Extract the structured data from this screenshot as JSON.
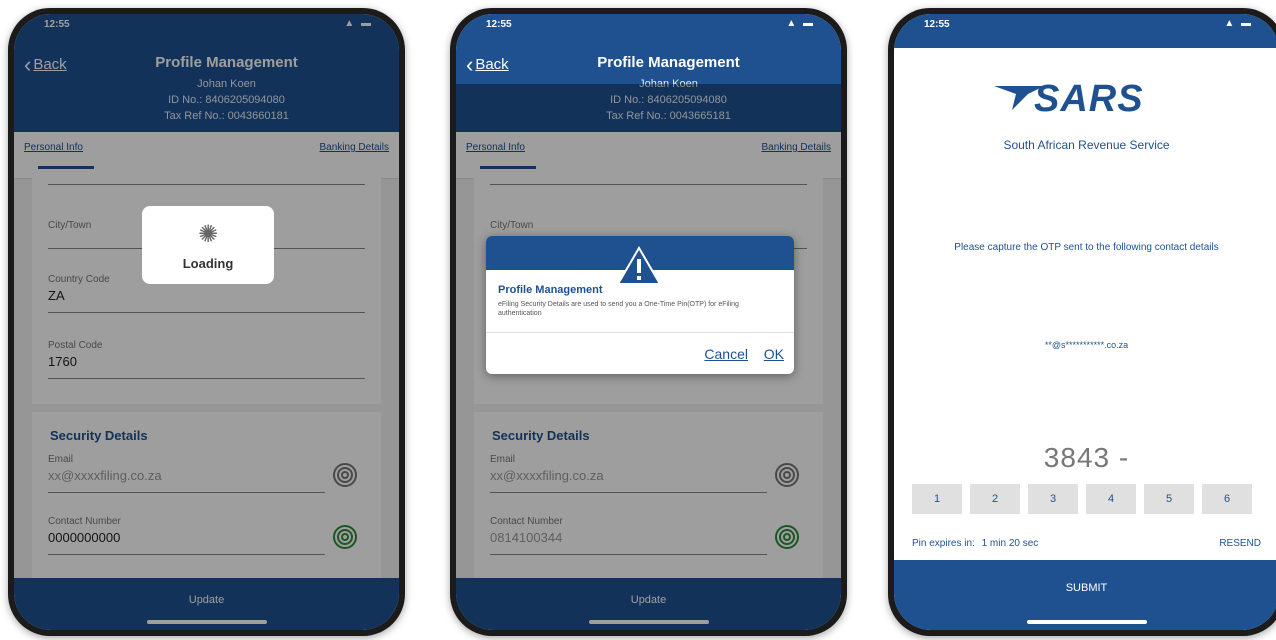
{
  "phone1": {
    "header": {
      "back": "Back",
      "title": "Profile Management",
      "name": "Johan Koen",
      "id_no": "ID No.: 8406205094080",
      "tax_ref": "Tax Ref No.: 0043660181"
    },
    "tabs": {
      "left": "Personal Info",
      "right": "Banking Details"
    },
    "fields": [
      {
        "label": "City/Town",
        "value": ""
      },
      {
        "label": "Country Code",
        "value": "ZA"
      },
      {
        "label": "Postal Code",
        "value": "1760"
      }
    ],
    "security": {
      "title": "Security Details",
      "email_label": "Email",
      "email_value": "xx@xxxxfiling.co.za",
      "contact_label": "Contact Number",
      "contact_value": "0000000000"
    },
    "loading": "Loading",
    "bottom_button": "Update"
  },
  "phone2": {
    "header": {
      "back": "Back",
      "title": "Profile Management",
      "name": "Johan Koen",
      "id_no": "ID No.: 8406205094080",
      "tax_ref": "Tax Ref No.: 0043665181"
    },
    "tabs": {
      "left": "Personal Info",
      "right": "Banking Details"
    },
    "field_label": "City/Town",
    "security": {
      "title": "Security Details",
      "email_label": "Email",
      "email_value": "xx@xxxxfiling.co.za",
      "contact_label": "Contact Number",
      "contact_value": "0814100344"
    },
    "dialog": {
      "title": "Profile Management",
      "message": "eFiling Security Details are used to send you a One-Time Pin(OTP) for eFiling authentication",
      "cancel": "Cancel",
      "ok": "OK"
    },
    "bottom_button": "Update"
  },
  "phone3": {
    "logo_text": "SARS",
    "org_name": "South African Revenue Service",
    "otp_message": "Please capture the OTP sent to the following contact details",
    "contact": "**@s***********.co.za",
    "otp_value": "3843 -",
    "keys": [
      "1",
      "2",
      "3",
      "4",
      "5",
      "6"
    ],
    "expires_label": "Pin expires in:",
    "expires_value": "1 min 20 sec",
    "resend": "RESEND",
    "submit": "SUBMIT"
  },
  "status_time": "12:55",
  "colors": {
    "brand": "#1f5190",
    "accent_green": "#2e8b3a"
  }
}
